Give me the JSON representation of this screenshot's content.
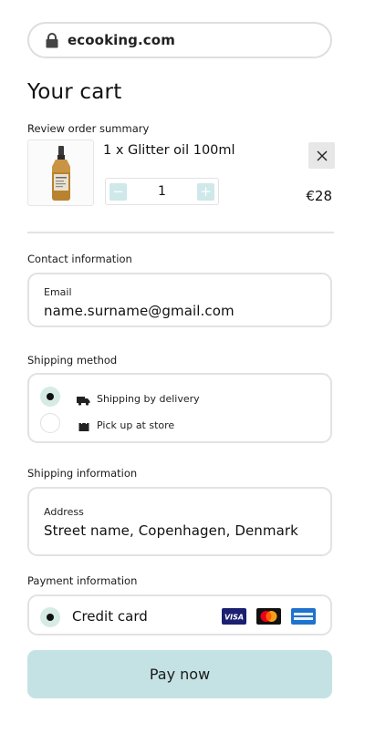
{
  "browser": {
    "url": "ecooking.com"
  },
  "page": {
    "title": "Your cart"
  },
  "order": {
    "section_label": "Review order summary",
    "item": {
      "name": "1 x Glitter oil 100ml",
      "quantity": "1",
      "price": "€28"
    },
    "stepper": {
      "minus": "−",
      "plus": "+"
    }
  },
  "contact": {
    "section_label": "Contact information",
    "email_label": "Email",
    "email_value": "name.surname@gmail.com"
  },
  "shipping_method": {
    "section_label": "Shipping method",
    "options": [
      {
        "label": "Shipping by delivery",
        "icon": "truck-icon",
        "selected": true
      },
      {
        "label": "Pick up at store",
        "icon": "shopping-bag-icon",
        "selected": false
      }
    ]
  },
  "shipping_info": {
    "section_label": "Shipping information",
    "address_label": "Address",
    "address_value": "Street name, Copenhagen, Denmark"
  },
  "payment": {
    "section_label": "Payment information",
    "method_label": "Credit card",
    "selected": true,
    "brands": [
      "visa-icon",
      "mastercard-icon",
      "amex-icon"
    ]
  },
  "actions": {
    "pay_label": "Pay now"
  },
  "colors": {
    "accent": "#c4e2e4",
    "radio_selected": "#d6ebe4",
    "stepper": "#cfe8ea"
  }
}
